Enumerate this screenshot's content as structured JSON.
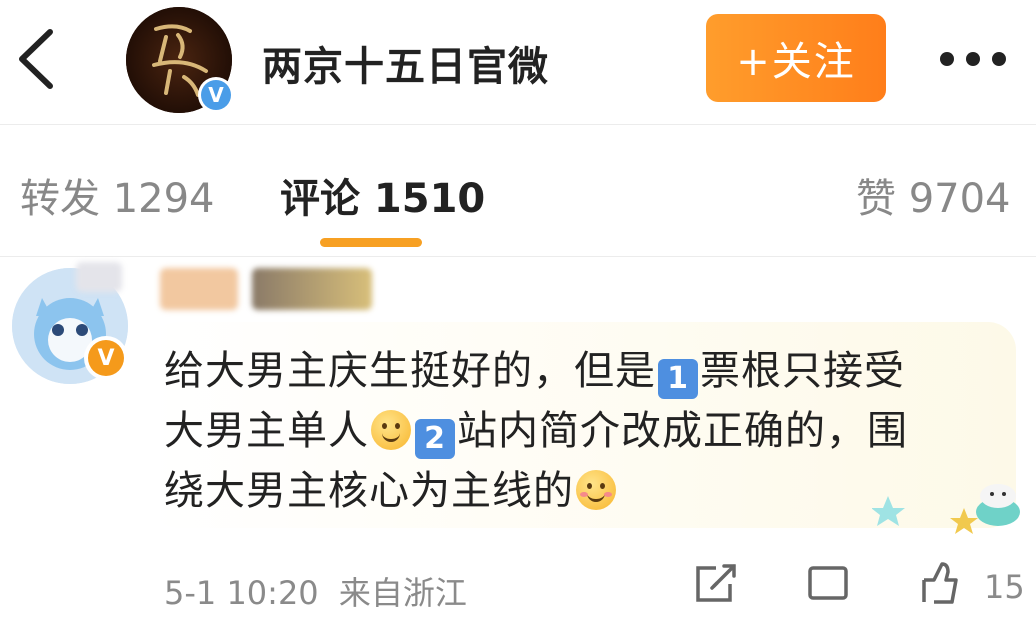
{
  "header": {
    "account_name": "两京十五日官微",
    "follow_label": "+关注",
    "avatar_calligraphy": "两京十五日"
  },
  "tabs": [
    {
      "label": "转发 1294"
    },
    {
      "label": "评论 1510"
    },
    {
      "label": "赞 9704"
    }
  ],
  "comment": {
    "line1_a": "给大男主庆生挺好的，但是",
    "key1": "1",
    "line1_b": "票根只接受",
    "line2_a": "大男主单人",
    "key2": "2",
    "line2_b": "站内简介改成正确的，围",
    "line3": "绕大男主核心为主线的",
    "timestamp": "5-1 10:20",
    "location": "来自浙江",
    "like_count_partial": "15"
  },
  "colors": {
    "accent_orange": "#ff8a1f",
    "tab_underline": "#f7a023",
    "verify_blue": "#4a9de8",
    "vip_badge": "#f59a1b"
  },
  "icons": [
    "back-arrow-icon",
    "verified-icon",
    "more-icon",
    "share-icon",
    "comment-icon",
    "like-icon",
    "smile-emoji-icon"
  ]
}
